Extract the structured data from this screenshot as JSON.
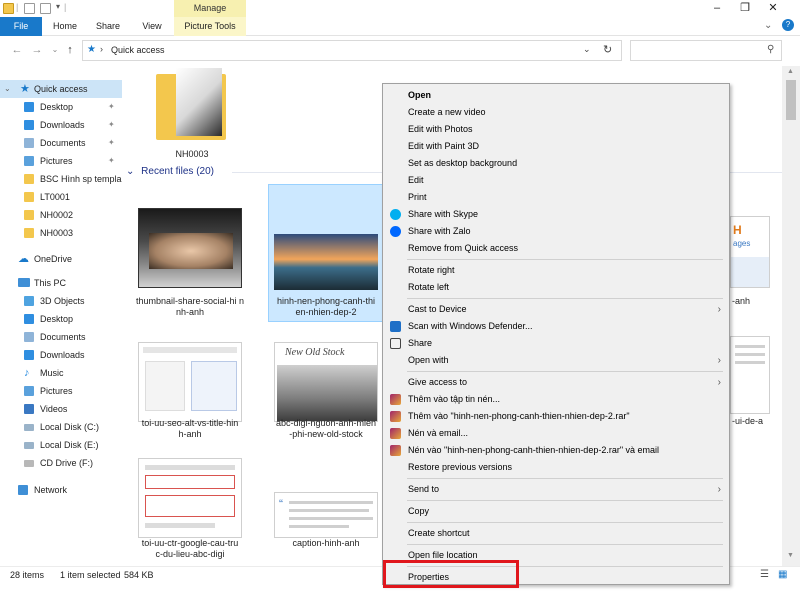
{
  "ribbon": {
    "context_group": "Manage",
    "tabs": [
      "File",
      "Home",
      "Share",
      "View",
      "Picture Tools"
    ]
  },
  "address": {
    "path": "Quick access",
    "search_placeholder": ""
  },
  "sidebar": {
    "quick_access": "Quick access",
    "items": [
      {
        "label": "Desktop",
        "icon": "desktop-folder-icon"
      },
      {
        "label": "Downloads",
        "icon": "downloads-folder-icon"
      },
      {
        "label": "Documents",
        "icon": "documents-folder-icon"
      },
      {
        "label": "Pictures",
        "icon": "pictures-folder-icon"
      },
      {
        "label": "BSC Hình sp templa",
        "icon": "folder-icon"
      },
      {
        "label": "LT0001",
        "icon": "folder-icon"
      },
      {
        "label": "NH0002",
        "icon": "folder-icon"
      },
      {
        "label": "NH0003",
        "icon": "folder-icon"
      }
    ],
    "onedrive": "OneDrive",
    "this_pc": "This PC",
    "pc_items": [
      {
        "label": "3D Objects",
        "icon": "3d-objects-icon"
      },
      {
        "label": "Desktop",
        "icon": "desktop-icon"
      },
      {
        "label": "Documents",
        "icon": "documents-icon"
      },
      {
        "label": "Downloads",
        "icon": "downloads-icon"
      },
      {
        "label": "Music",
        "icon": "music-icon"
      },
      {
        "label": "Pictures",
        "icon": "pictures-icon"
      },
      {
        "label": "Videos",
        "icon": "videos-icon"
      },
      {
        "label": "Local Disk (C:)",
        "icon": "drive-icon"
      },
      {
        "label": "Local Disk (E:)",
        "icon": "drive-icon"
      },
      {
        "label": "CD Drive (F:)",
        "icon": "cd-drive-icon"
      }
    ],
    "network": "Network"
  },
  "main": {
    "folder_name": "NH0003",
    "recent_header": "Recent files (20)",
    "files": [
      {
        "line1": "thumbnail-share-social-hi n",
        "line2": "nh-anh"
      },
      {
        "line1": "hinh-nen-phong-canh-thi",
        "line2": "en-nhien-dep-2"
      },
      {
        "line1": "toi-uu-seo-alt-vs-title-hin",
        "line2": "h-anh"
      },
      {
        "line1": "abc-digi-nguon-anh-mien",
        "line2": "-phi-new-old-stock"
      },
      {
        "line1": "toi-uu-ctr-google-cau-tru",
        "line2": "c-du-lieu-abc-digi"
      },
      {
        "line1": "caption-hinh-anh",
        "line2": ""
      }
    ],
    "partial_right": [
      "-anh",
      "-ui-de-a"
    ],
    "thumb_text": {
      "old_stock": "New Old Stock",
      "partial_logo": "H",
      "partial_sub": "ages"
    }
  },
  "status": {
    "items_count": "28 items",
    "selection": "1 item selected",
    "size": "584 KB"
  },
  "context_menu": {
    "group1": [
      "Open",
      "Create a new video",
      "Edit with Photos",
      "Edit with Paint 3D",
      "Set as desktop background",
      "Edit",
      "Print",
      "Share with Skype",
      "Share with Zalo",
      "Remove from Quick access"
    ],
    "group2": [
      "Rotate right",
      "Rotate left"
    ],
    "group3": [
      "Cast to Device",
      "Scan with Windows Defender...",
      "Share",
      "Open with"
    ],
    "group4": [
      "Give access to",
      "Thêm vào tập tin nén...",
      "Thêm vào \"hinh-nen-phong-canh-thien-nhien-dep-2.rar\"",
      "Nén và email...",
      "Nén vào \"hinh-nen-phong-canh-thien-nhien-dep-2.rar\" và email",
      "Restore previous versions"
    ],
    "group5": [
      "Send to"
    ],
    "group6": [
      "Copy"
    ],
    "group7": [
      "Create shortcut"
    ],
    "group8": [
      "Open file location"
    ],
    "group9": [
      "Properties"
    ]
  },
  "colors": {
    "accent": "#1979ca",
    "selection": "#cce8ff",
    "highlight_box": "#e0161c"
  }
}
